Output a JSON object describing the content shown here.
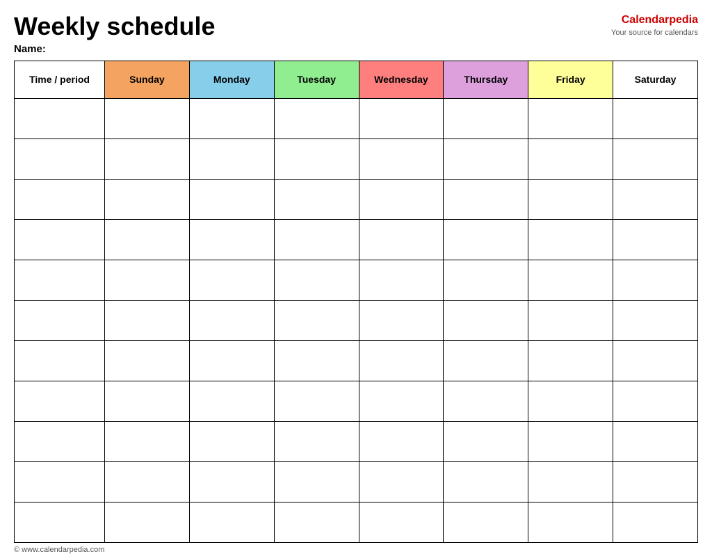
{
  "header": {
    "title": "Weekly schedule",
    "brand_name_plain": "Calendar",
    "brand_name_accent": "pedia",
    "brand_sub": "Your source for calendars",
    "name_label": "Name:"
  },
  "table": {
    "columns": [
      {
        "id": "time",
        "label": "Time / period",
        "class": "col-time"
      },
      {
        "id": "sunday",
        "label": "Sunday",
        "class": "col-sunday"
      },
      {
        "id": "monday",
        "label": "Monday",
        "class": "col-monday"
      },
      {
        "id": "tuesday",
        "label": "Tuesday",
        "class": "col-tuesday"
      },
      {
        "id": "wednesday",
        "label": "Wednesday",
        "class": "col-wednesday"
      },
      {
        "id": "thursday",
        "label": "Thursday",
        "class": "col-thursday"
      },
      {
        "id": "friday",
        "label": "Friday",
        "class": "col-friday"
      },
      {
        "id": "saturday",
        "label": "Saturday",
        "class": "col-saturday"
      }
    ],
    "row_count": 11
  },
  "footer": {
    "text": "© www.calendarpedia.com"
  }
}
